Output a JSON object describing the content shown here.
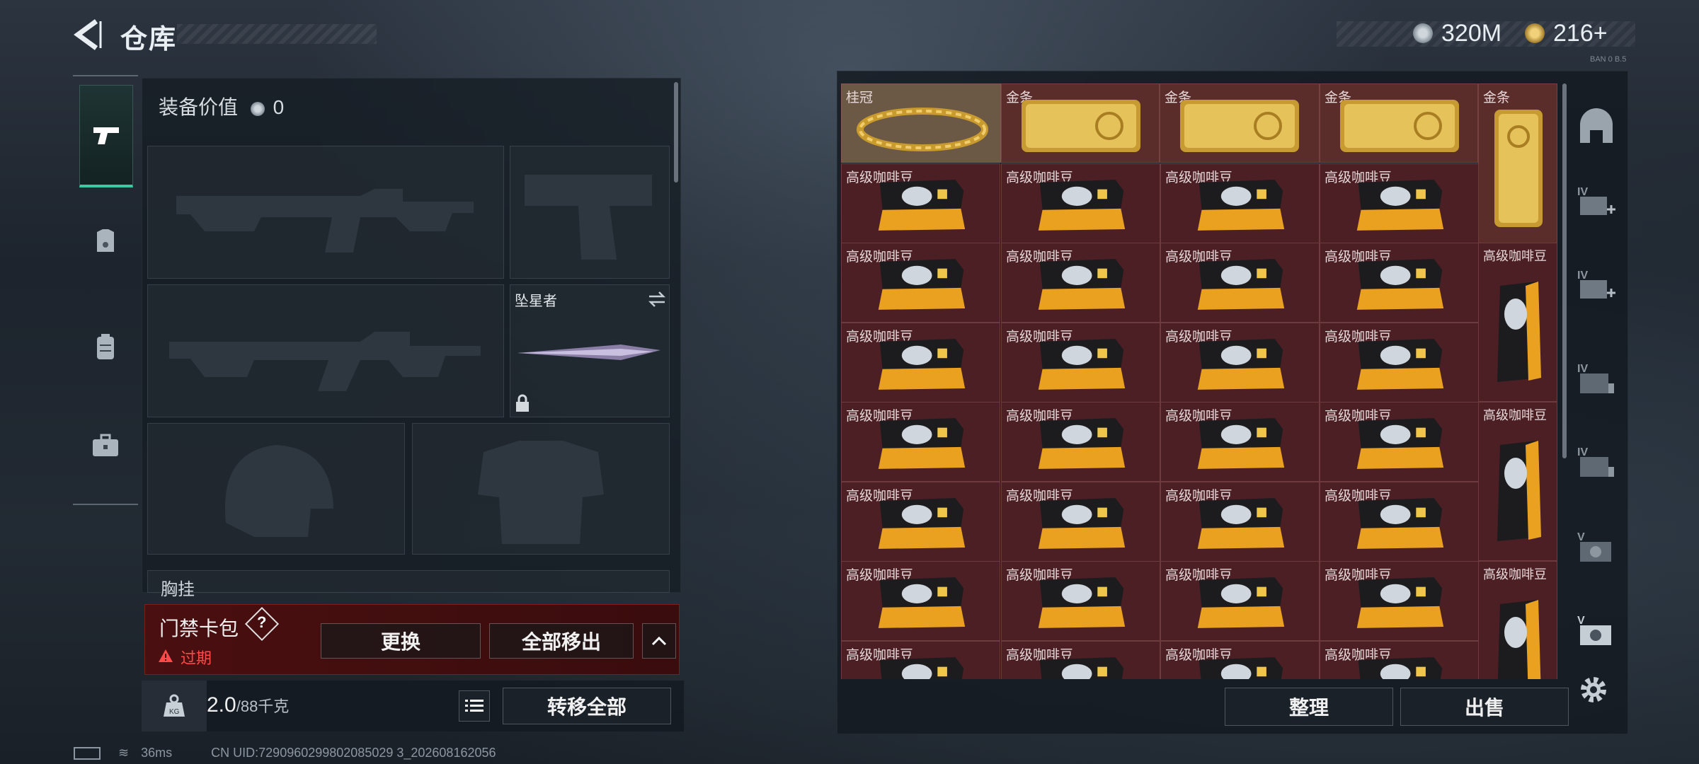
{
  "header": {
    "title": "仓库",
    "currency_1": "320M",
    "currency_2": "216+",
    "tiny_code": "BAN 0 B.5"
  },
  "equipment": {
    "value_label": "装备价值",
    "value": "0",
    "knife_name": "坠星者",
    "chest_label": "胸挂"
  },
  "access_card": {
    "title": "门禁卡包",
    "help": "?",
    "status": "过期",
    "replace_button": "更换",
    "remove_all_button": "全部移出",
    "collapse": "^"
  },
  "weight": {
    "current": "2.0",
    "max": "/88千克",
    "transfer_all_button": "转移全部"
  },
  "storage": {
    "sort_button": "整理",
    "sell_button": "出售",
    "items": {
      "crown": "桂冠",
      "gold": "金条",
      "coffee": "高级咖啡豆"
    }
  },
  "status": {
    "ping": "36ms",
    "uid": "CN UID:7290960299802085029 3_202608162056"
  },
  "colors": {
    "accent": "#3ec7a0",
    "expired": "#ff4a4a",
    "cell_bg": "#4b1f24"
  }
}
